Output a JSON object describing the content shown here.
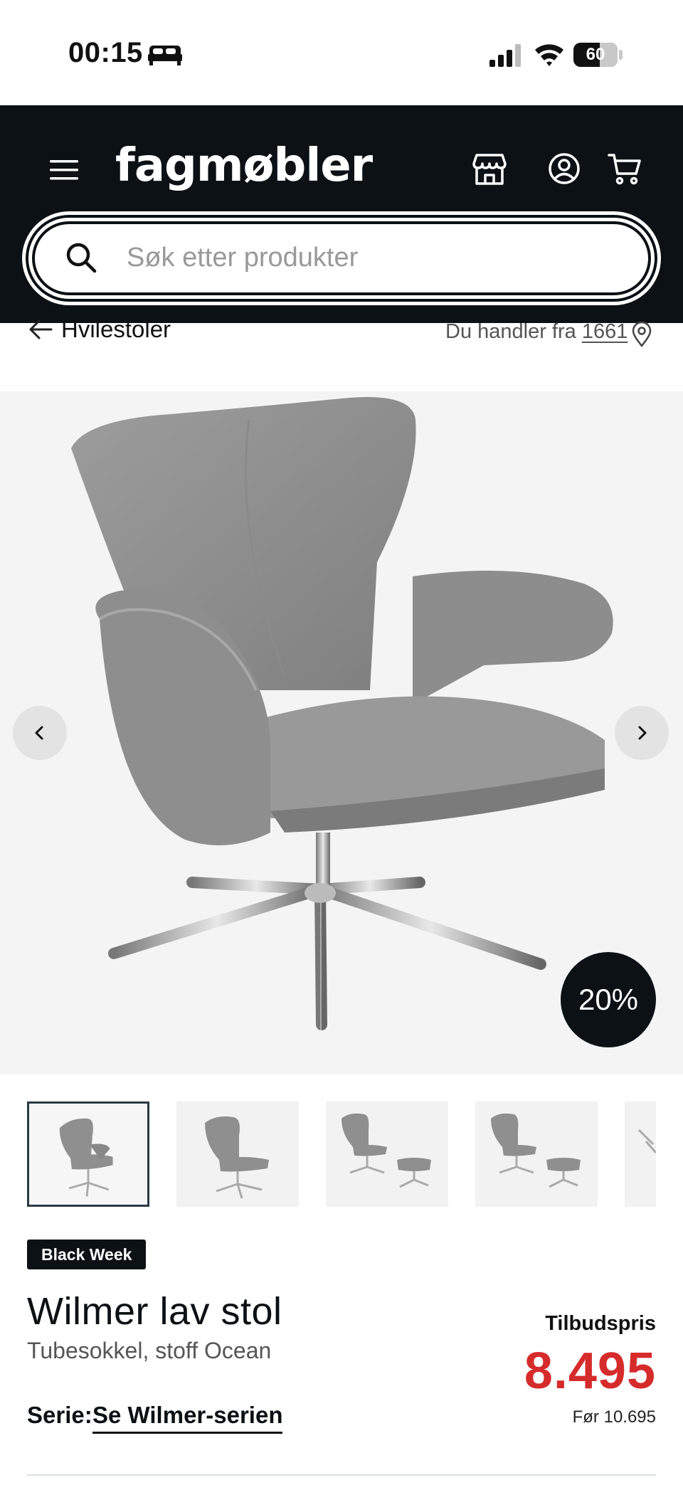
{
  "status_bar": {
    "time": "00:15",
    "battery": "60",
    "battery_level": 0.6,
    "icons": [
      "bed-icon",
      "signal-icon",
      "wifi-icon",
      "battery-icon"
    ]
  },
  "header": {
    "logo": "fagmøbler",
    "icons": [
      "menu-icon",
      "store-icon",
      "account-icon",
      "cart-icon"
    ],
    "background_color": "#0b1114"
  },
  "search": {
    "placeholder": "Søk etter produkter",
    "value": ""
  },
  "breadcrumb": {
    "label": "Hvilestoler"
  },
  "location": {
    "prefix": "Du handler fra",
    "zip": "1661"
  },
  "gallery": {
    "discount_badge": "20%",
    "thumbnail_count": 5
  },
  "product": {
    "campaign_badge": "Black Week",
    "title": "Wilmer lav stol",
    "subtitle": "Tubesokkel, stoff Ocean",
    "series_label": "Serie:",
    "series_link": "Se Wilmer-serien",
    "price_label": "Tilbudspris",
    "price_now": "8.495",
    "price_before": "Før 10.695",
    "price_color": "#d62b2b"
  }
}
